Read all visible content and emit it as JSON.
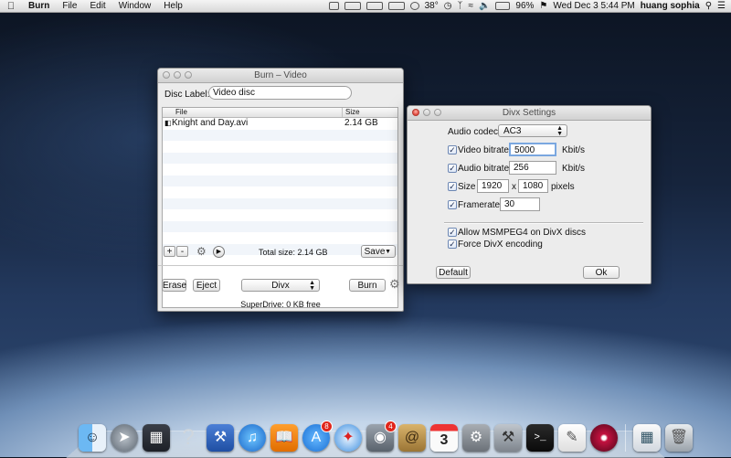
{
  "menubar": {
    "app_name": "Burn",
    "items": [
      "File",
      "Edit",
      "Window",
      "Help"
    ],
    "temperature": "38°",
    "battery": "96%",
    "datetime": "Wed Dec 3  5:44 PM",
    "user": "huang sophia"
  },
  "burn_window": {
    "title": "Burn – Video",
    "disc_label_caption": "Disc Label:",
    "disc_label_value": "Video disc",
    "columns": {
      "file": "File",
      "size": "Size"
    },
    "rows": [
      {
        "file": "Knight and Day.avi",
        "size": "2.14 GB"
      }
    ],
    "add_label": "+",
    "remove_label": "-",
    "total_size": "Total size: 2.14 GB",
    "save_label": "Save",
    "erase_label": "Erase",
    "eject_label": "Eject",
    "format_value": "Divx",
    "burn_label": "Burn",
    "status": "SuperDrive: 0 KB free"
  },
  "divx_window": {
    "title": "Divx Settings",
    "audio_codec_label": "Audio codec:",
    "audio_codec_value": "AC3",
    "video_bitrate_label": "Video bitrate",
    "video_bitrate_value": "5000",
    "video_bitrate_unit": "Kbit/s",
    "audio_bitrate_label": "Audio bitrate",
    "audio_bitrate_value": "256",
    "audio_bitrate_unit": "Kbit/s",
    "size_label": "Size",
    "width_value": "1920",
    "size_x": "x",
    "height_value": "1080",
    "size_unit": "pixels",
    "framerate_label": "Framerate",
    "framerate_value": "30",
    "allow_msmpeg4_label": "Allow MSMPEG4 on DivX discs",
    "force_divx_label": "Force DivX encoding",
    "default_label": "Default",
    "ok_label": "Ok"
  },
  "dock": {
    "icons": [
      "finder-icon",
      "launchpad-icon",
      "mission-control-icon",
      "help-icon",
      "xcode-icon",
      "itunes-icon",
      "ibooks-icon",
      "app-store-icon",
      "safari-icon",
      "facetime-icon",
      "contacts-icon",
      "calendar-icon",
      "system-preferences-icon",
      "directory-utility-icon",
      "terminal-icon",
      "textedit-icon",
      "dvd-player-icon",
      "preview-icon",
      "trash-icon"
    ],
    "app_store_badge": "8",
    "facetime_badge": "4",
    "calendar_day": "3"
  }
}
